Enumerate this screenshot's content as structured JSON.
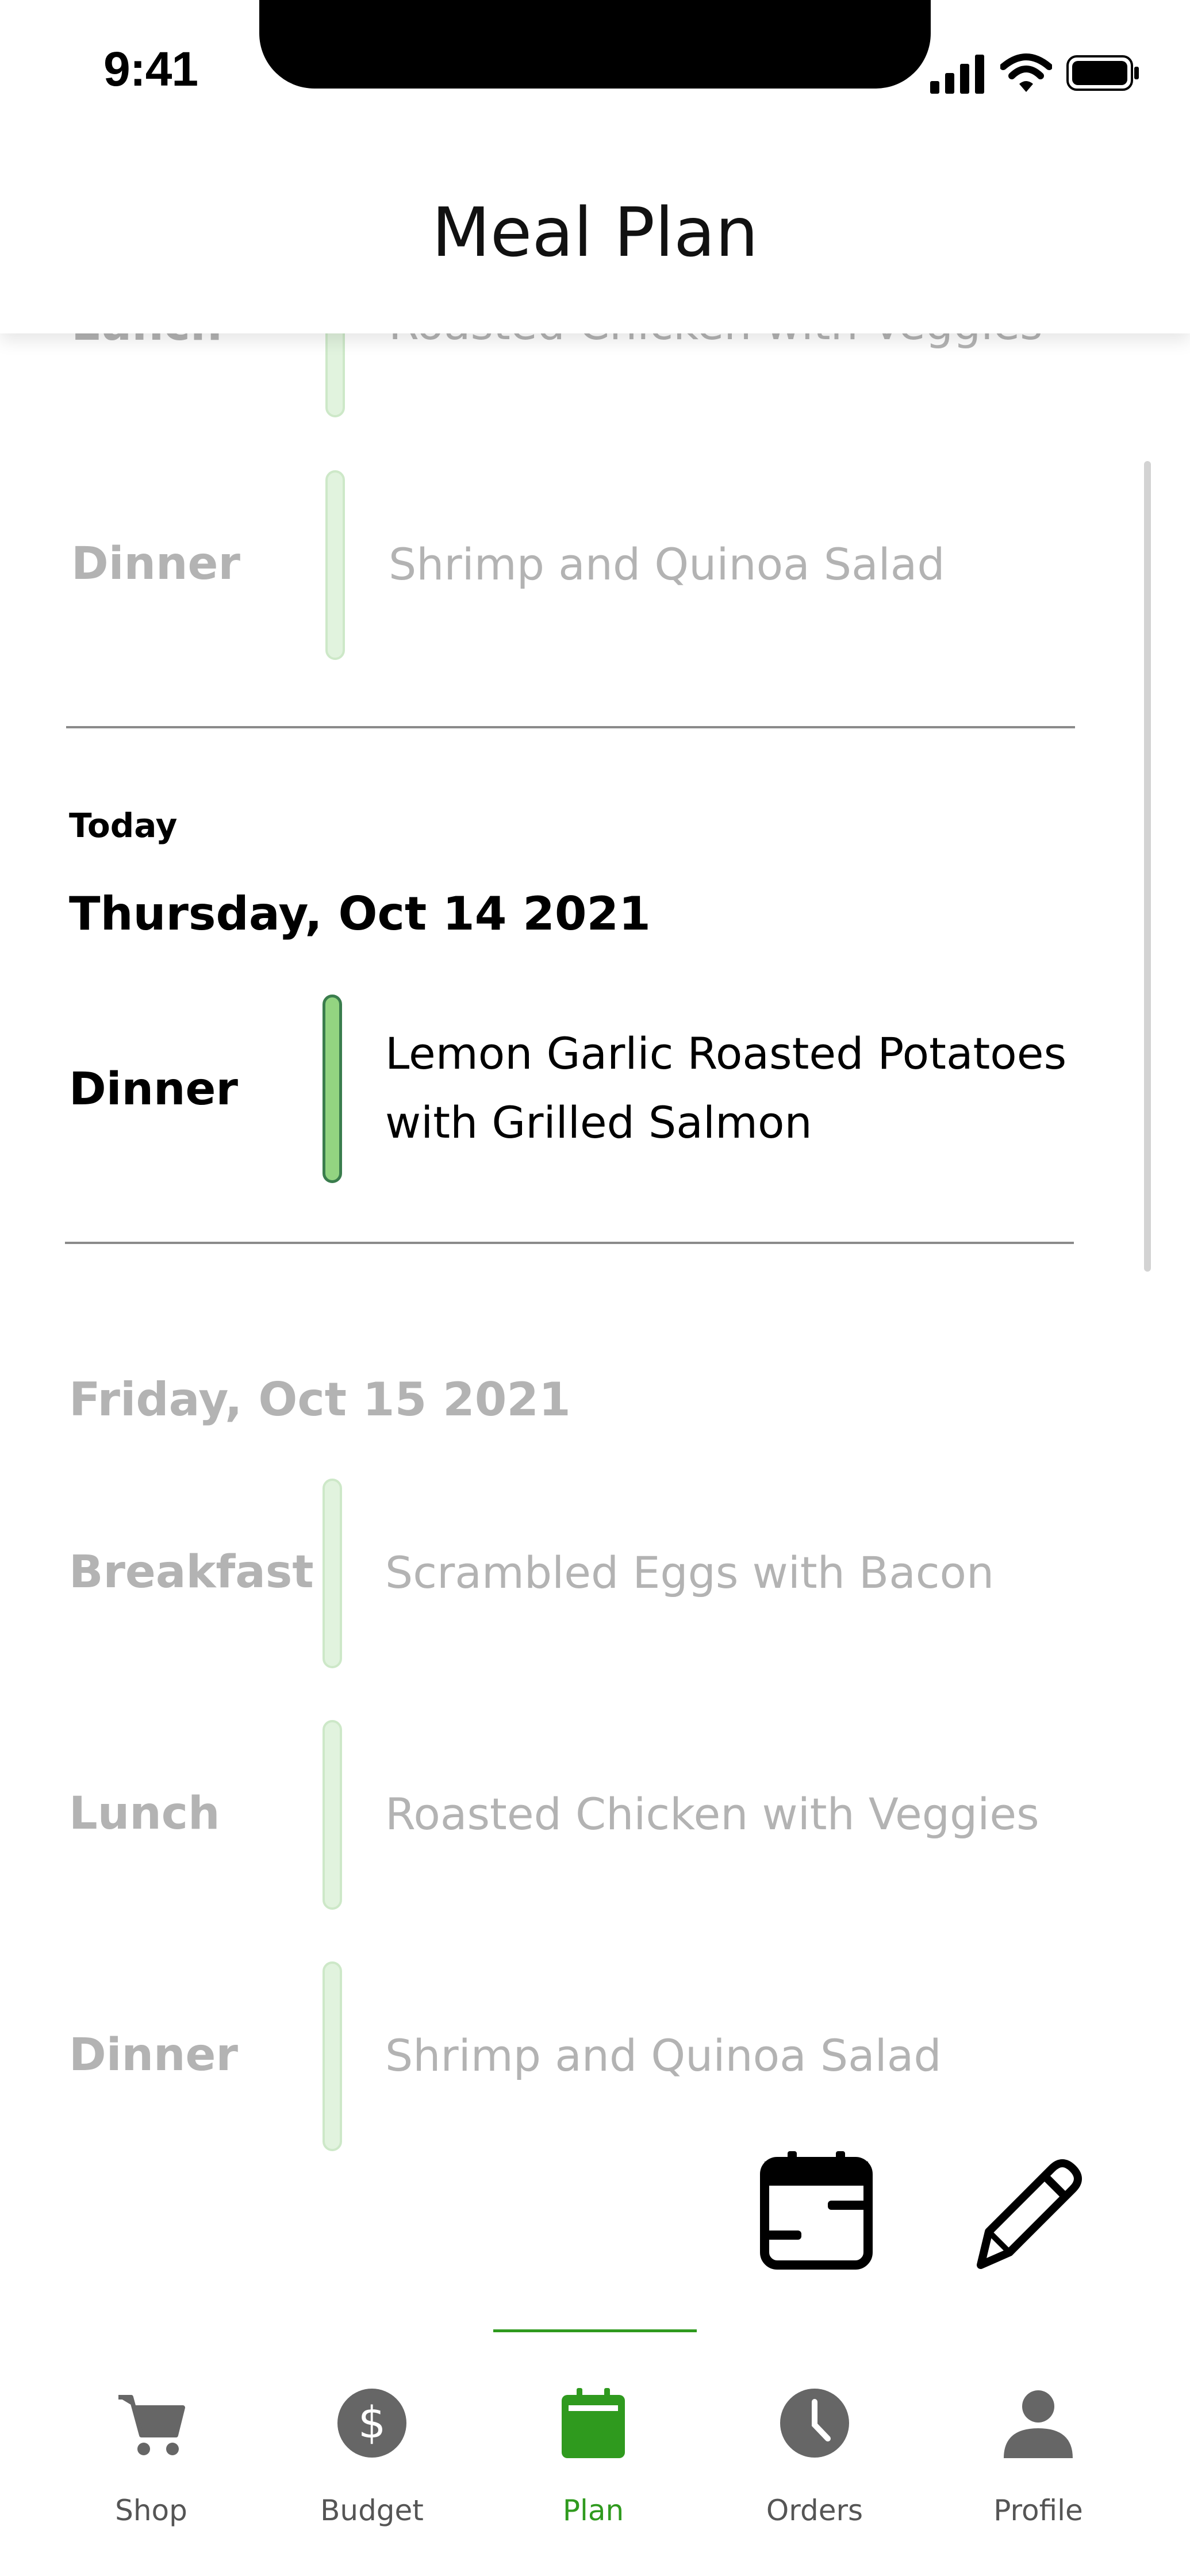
{
  "status_bar": {
    "time": "9:41"
  },
  "header": {
    "title": "Meal Plan"
  },
  "previous_day": {
    "meals": [
      {
        "label": "Lunch",
        "name": "Roasted Chicken with Veggies"
      },
      {
        "label": "Dinner",
        "name": "Shrimp and Quinoa Salad"
      }
    ]
  },
  "today": {
    "tag": "Today",
    "date": "Thursday, Oct 14 2021",
    "meals": [
      {
        "label": "Dinner",
        "name_line1": "Lemon Garlic Roasted Potatoes",
        "name_line2": "with Grilled Salmon"
      }
    ]
  },
  "next_day": {
    "date": "Friday, Oct 15 2021",
    "meals": [
      {
        "label": "Breakfast",
        "name": "Scrambled Eggs with Bacon"
      },
      {
        "label": "Lunch",
        "name": "Roasted Chicken with Veggies"
      },
      {
        "label": "Dinner",
        "name": "Shrimp and Quinoa Salad"
      }
    ]
  },
  "fab": {
    "calendar_icon": "calendar-icon",
    "edit_icon": "pencil-icon"
  },
  "tabs": [
    {
      "label": "Shop",
      "icon": "cart-icon"
    },
    {
      "label": "Budget",
      "icon": "dollar-icon"
    },
    {
      "label": "Plan",
      "icon": "calendar-icon"
    },
    {
      "label": "Orders",
      "icon": "clock-icon"
    },
    {
      "label": "Profile",
      "icon": "person-icon"
    }
  ],
  "colors": {
    "accent": "#2f9a1e",
    "active_bar": "#93d481",
    "inactive_bar": "#e1f3de",
    "muted_text": "#b3b3b3",
    "icon_gray": "#666666"
  }
}
